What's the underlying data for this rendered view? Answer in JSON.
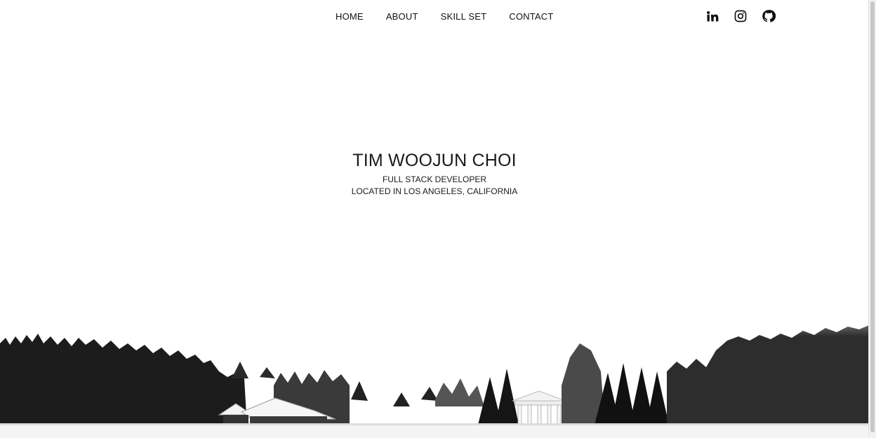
{
  "nav": {
    "links": [
      {
        "label": "HOME"
      },
      {
        "label": "ABOUT"
      },
      {
        "label": "SKILL SET"
      },
      {
        "label": "CONTACT"
      }
    ],
    "social": [
      {
        "icon": "linkedin-icon"
      },
      {
        "icon": "instagram-icon"
      },
      {
        "icon": "github-icon"
      }
    ]
  },
  "hero": {
    "name": "TIM WOOJUN CHOI",
    "role": "FULL STACK DEVELOPER",
    "location": "LOCATED IN LOS ANGELES, CALIFORNIA"
  },
  "background": {
    "description_colors": {
      "sky": "#ffffff",
      "trees": "#1a1a1a",
      "snow": "#f4f4f4"
    }
  }
}
